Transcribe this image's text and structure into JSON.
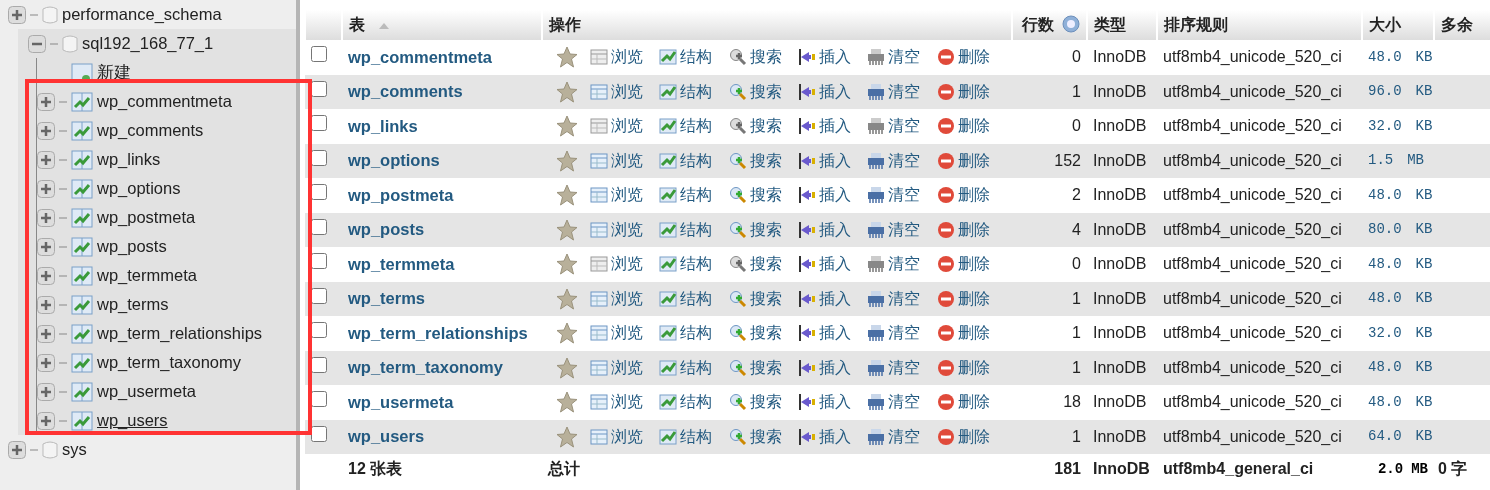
{
  "sidebar": {
    "highlighted": true,
    "databases": [
      {
        "name": "performance_schema",
        "expanded": false
      },
      {
        "name": "sql192_168_77_1",
        "expanded": true,
        "children": [
          {
            "kind": "new",
            "label": "新建"
          },
          {
            "kind": "table",
            "label": "wp_commentmeta",
            "underlined": false
          },
          {
            "kind": "table",
            "label": "wp_comments",
            "underlined": false
          },
          {
            "kind": "table",
            "label": "wp_links",
            "underlined": false
          },
          {
            "kind": "table",
            "label": "wp_options",
            "underlined": false
          },
          {
            "kind": "table",
            "label": "wp_postmeta",
            "underlined": false
          },
          {
            "kind": "table",
            "label": "wp_posts",
            "underlined": false
          },
          {
            "kind": "table",
            "label": "wp_termmeta",
            "underlined": false
          },
          {
            "kind": "table",
            "label": "wp_terms",
            "underlined": false
          },
          {
            "kind": "table",
            "label": "wp_term_relationships",
            "underlined": false
          },
          {
            "kind": "table",
            "label": "wp_term_taxonomy",
            "underlined": false
          },
          {
            "kind": "table",
            "label": "wp_usermeta",
            "underlined": false
          },
          {
            "kind": "table",
            "label": "wp_users",
            "underlined": true
          }
        ]
      },
      {
        "name": "sys",
        "expanded": false
      }
    ]
  },
  "table": {
    "columns": [
      {
        "label": "表",
        "kind": "sort"
      },
      {
        "label": "操作",
        "kind": "plain"
      },
      {
        "label": "行数",
        "kind": "help"
      },
      {
        "label": "类型",
        "kind": "plain"
      },
      {
        "label": "排序规则",
        "kind": "plain"
      },
      {
        "label": "大小",
        "kind": "plain"
      },
      {
        "label": "多余",
        "kind": "plain"
      }
    ],
    "rows": [
      {
        "checked": false,
        "name": "wp_commentmeta",
        "empty": true,
        "actions": [
          "浏览",
          "结构",
          "搜索",
          "插入",
          "清空",
          "删除"
        ],
        "rows": "0",
        "type": "InnoDB",
        "collation": "utf8mb4_unicode_520_ci",
        "size": "48.0",
        "unit": "KB"
      },
      {
        "checked": false,
        "name": "wp_comments",
        "empty": false,
        "actions": [
          "浏览",
          "结构",
          "搜索",
          "插入",
          "清空",
          "删除"
        ],
        "rows": "1",
        "type": "InnoDB",
        "collation": "utf8mb4_unicode_520_ci",
        "size": "96.0",
        "unit": "KB"
      },
      {
        "checked": false,
        "name": "wp_links",
        "empty": true,
        "actions": [
          "浏览",
          "结构",
          "搜索",
          "插入",
          "清空",
          "删除"
        ],
        "rows": "0",
        "type": "InnoDB",
        "collation": "utf8mb4_unicode_520_ci",
        "size": "32.0",
        "unit": "KB"
      },
      {
        "checked": false,
        "name": "wp_options",
        "empty": false,
        "actions": [
          "浏览",
          "结构",
          "搜索",
          "插入",
          "清空",
          "删除"
        ],
        "rows": "152",
        "type": "InnoDB",
        "collation": "utf8mb4_unicode_520_ci",
        "size": "1.5",
        "unit": "MB"
      },
      {
        "checked": false,
        "name": "wp_postmeta",
        "empty": false,
        "actions": [
          "浏览",
          "结构",
          "搜索",
          "插入",
          "清空",
          "删除"
        ],
        "rows": "2",
        "type": "InnoDB",
        "collation": "utf8mb4_unicode_520_ci",
        "size": "48.0",
        "unit": "KB"
      },
      {
        "checked": false,
        "name": "wp_posts",
        "empty": false,
        "actions": [
          "浏览",
          "结构",
          "搜索",
          "插入",
          "清空",
          "删除"
        ],
        "rows": "4",
        "type": "InnoDB",
        "collation": "utf8mb4_unicode_520_ci",
        "size": "80.0",
        "unit": "KB"
      },
      {
        "checked": false,
        "name": "wp_termmeta",
        "empty": true,
        "actions": [
          "浏览",
          "结构",
          "搜索",
          "插入",
          "清空",
          "删除"
        ],
        "rows": "0",
        "type": "InnoDB",
        "collation": "utf8mb4_unicode_520_ci",
        "size": "48.0",
        "unit": "KB"
      },
      {
        "checked": false,
        "name": "wp_terms",
        "empty": false,
        "actions": [
          "浏览",
          "结构",
          "搜索",
          "插入",
          "清空",
          "删除"
        ],
        "rows": "1",
        "type": "InnoDB",
        "collation": "utf8mb4_unicode_520_ci",
        "size": "48.0",
        "unit": "KB"
      },
      {
        "checked": false,
        "name": "wp_term_relationships",
        "empty": false,
        "actions": [
          "浏览",
          "结构",
          "搜索",
          "插入",
          "清空",
          "删除"
        ],
        "rows": "1",
        "type": "InnoDB",
        "collation": "utf8mb4_unicode_520_ci",
        "size": "32.0",
        "unit": "KB"
      },
      {
        "checked": false,
        "name": "wp_term_taxonomy",
        "empty": false,
        "actions": [
          "浏览",
          "结构",
          "搜索",
          "插入",
          "清空",
          "删除"
        ],
        "rows": "1",
        "type": "InnoDB",
        "collation": "utf8mb4_unicode_520_ci",
        "size": "48.0",
        "unit": "KB"
      },
      {
        "checked": false,
        "name": "wp_usermeta",
        "empty": false,
        "actions": [
          "浏览",
          "结构",
          "搜索",
          "插入",
          "清空",
          "删除"
        ],
        "rows": "18",
        "type": "InnoDB",
        "collation": "utf8mb4_unicode_520_ci",
        "size": "48.0",
        "unit": "KB"
      },
      {
        "checked": false,
        "name": "wp_users",
        "empty": false,
        "actions": [
          "浏览",
          "结构",
          "搜索",
          "插入",
          "清空",
          "删除"
        ],
        "rows": "1",
        "type": "InnoDB",
        "collation": "utf8mb4_unicode_520_ci",
        "size": "64.0",
        "unit": "KB"
      }
    ],
    "footer": {
      "count": "12 张表",
      "label": "总计",
      "rows": "181",
      "type": "InnoDB",
      "collation": "utf8mb4_general_ci",
      "size": "2.0",
      "unit": "MB",
      "overhead": "0 字"
    }
  }
}
